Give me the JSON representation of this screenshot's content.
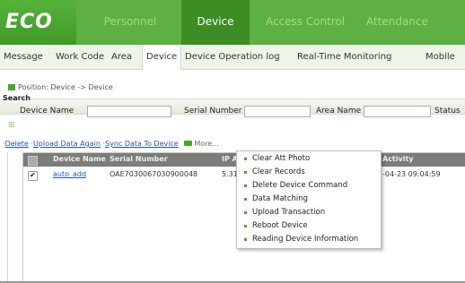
{
  "logo": {
    "text": "ECO"
  },
  "mainnav": [
    {
      "label": "Personnel",
      "active": false
    },
    {
      "label": "Device",
      "active": true
    },
    {
      "label": "Access Control",
      "active": false
    },
    {
      "label": "Attendance",
      "active": false
    }
  ],
  "subnav": [
    {
      "label": "Message",
      "active": false
    },
    {
      "label": "Work Code",
      "active": false
    },
    {
      "label": "Area",
      "active": false
    },
    {
      "label": "Device",
      "active": true
    },
    {
      "label": "Device Operation log",
      "active": false
    },
    {
      "label": "Real-Time Monitoring",
      "active": false
    },
    {
      "label": "Mobile",
      "active": false
    }
  ],
  "position": {
    "text": "Position: Device -> Device"
  },
  "search": {
    "label": "Search",
    "device_name_label": "Device Name",
    "device_name_value": "",
    "serial_number_label": "Serial Number",
    "serial_number_value": "",
    "area_name_label": "Area Name",
    "area_name_value": "",
    "status_label": "Status"
  },
  "actions": {
    "delete": "Delete",
    "upload_again": "Upload Data Again",
    "sync": "Sync Data To Device",
    "more": "More..."
  },
  "grid": {
    "headers": {
      "device_name": "Device Name",
      "serial_number": "Serial Number",
      "ip": "IP A",
      "activity": "Activity"
    },
    "rows": [
      {
        "checked": "✔",
        "device_name": "auto_add",
        "serial_number": "OAE7030067030900048",
        "ip": "5.31",
        "activity": "-04-23 09:04:59"
      }
    ]
  },
  "menu": {
    "items": [
      "Clear Att Photo",
      "Clear Records",
      "Delete Device Command",
      "Data Matching",
      "Upload Transaction",
      "Reboot Device",
      "Reading Device Information"
    ]
  },
  "colors": {
    "brand_green": "#5db042",
    "active_green": "#3c8d24",
    "link_blue": "#2255aa"
  }
}
